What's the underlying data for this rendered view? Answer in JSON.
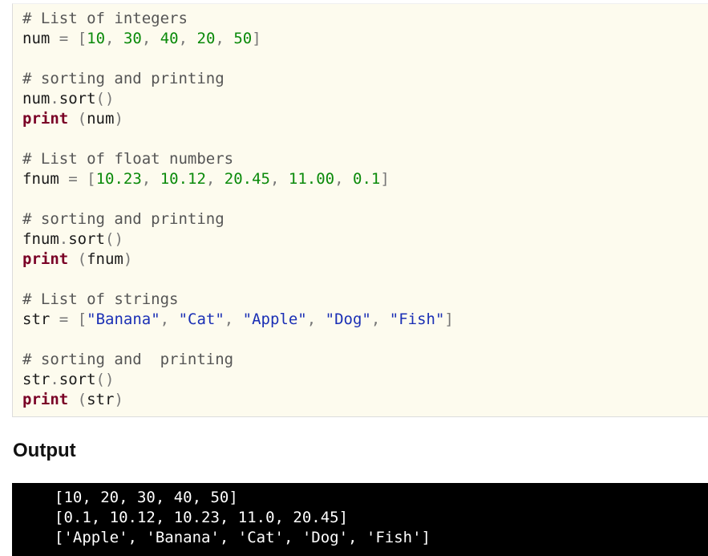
{
  "code": {
    "lines": [
      "# List of integers",
      "num = [10, 30, 40, 20, 50]",
      "",
      "# sorting and printing",
      "num.sort()",
      "print (num)",
      "",
      "# List of float numbers",
      "fnum = [10.23, 10.12, 20.45, 11.00, 0.1]",
      "",
      "# sorting and printing",
      "fnum.sort()",
      "print (fnum)",
      "",
      "# List of strings",
      "str = [\"Banana\", \"Cat\", \"Apple\", \"Dog\", \"Fish\"]",
      "",
      "# sorting and  printing",
      "str.sort()",
      "print (str)"
    ]
  },
  "output": {
    "heading": "Output",
    "lines": [
      "[10, 20, 30, 40, 50]",
      "[0.1, 10.12, 10.23, 11.0, 20.45]",
      "['Apple', 'Banana', 'Cat', 'Dog', 'Fish']"
    ]
  },
  "colors": {
    "code_background": "#fdfbee",
    "comment": "#555555",
    "number": "#0a8a0a",
    "string": "#1a2fb5",
    "keyword": "#7a0026",
    "output_background": "#000000",
    "output_text": "#ffffff"
  }
}
